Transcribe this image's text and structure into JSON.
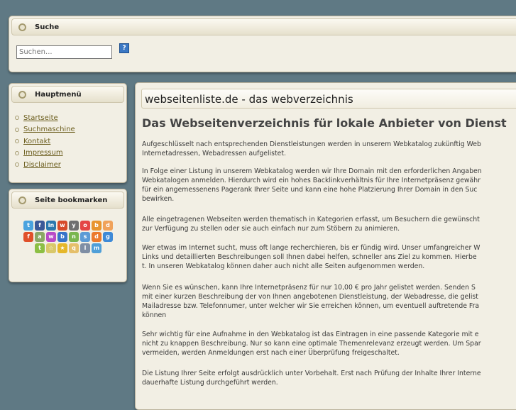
{
  "search": {
    "title": "Suche",
    "placeholder": "Suchen...",
    "help_label": "?"
  },
  "menu": {
    "title": "Hauptmenü",
    "items": [
      {
        "label": "Startseite"
      },
      {
        "label": "Suchmaschine"
      },
      {
        "label": "Kontakt"
      },
      {
        "label": "Impressum"
      },
      {
        "label": "Disclaimer"
      }
    ]
  },
  "bookmarks": {
    "title": "Seite bookmarken",
    "icons": [
      {
        "name": "twitter-icon",
        "glyph": "t",
        "color": "#4aa3df"
      },
      {
        "name": "facebook-icon",
        "glyph": "f",
        "color": "#3b5998"
      },
      {
        "name": "linkedin-icon",
        "glyph": "in",
        "color": "#2b78ae"
      },
      {
        "name": "mister-wong-icon",
        "glyph": "w",
        "color": "#d64b2b"
      },
      {
        "name": "yigg-icon",
        "glyph": "y",
        "color": "#6f6f6f"
      },
      {
        "name": "oneview-icon",
        "glyph": "o",
        "color": "#e44646"
      },
      {
        "name": "bookmarks-icon",
        "glyph": "b",
        "color": "#e8952e"
      },
      {
        "name": "delicious-icon",
        "glyph": "d",
        "color": "#f0a25a"
      },
      {
        "name": "folkd-icon",
        "glyph": "f",
        "color": "#e0502a"
      },
      {
        "name": "linkarena-icon",
        "glyph": "a",
        "color": "#8aa865"
      },
      {
        "name": "webnews-icon",
        "glyph": "w",
        "color": "#b84cc7"
      },
      {
        "name": "blinklist-icon",
        "glyph": "b",
        "color": "#3673c9"
      },
      {
        "name": "newsvine-icon",
        "glyph": "n",
        "color": "#7ab64e"
      },
      {
        "name": "stumbleupon-icon",
        "glyph": "s",
        "color": "#5c9bd6"
      },
      {
        "name": "digg-icon",
        "glyph": "d",
        "color": "#ec7a2c"
      },
      {
        "name": "google-icon",
        "glyph": "g",
        "color": "#3e8ad7"
      },
      {
        "name": "technorati-icon",
        "glyph": "t",
        "color": "#8cbf44"
      },
      {
        "name": "favorite-star-icon",
        "glyph": "☆",
        "color": "#d9c86a"
      },
      {
        "name": "star-icon",
        "glyph": "★",
        "color": "#e5b72a"
      },
      {
        "name": "search-bubble-icon",
        "glyph": "q",
        "color": "#e5bf6a"
      },
      {
        "name": "live-icon",
        "glyph": "l",
        "color": "#7f8ea4"
      },
      {
        "name": "misc-icon",
        "glyph": "m",
        "color": "#4f9fd8"
      }
    ]
  },
  "content": {
    "site_title": "webseitenliste.de - das webverzeichnis",
    "article_title": "Das Webseitenverzeichnis für lokale Anbieter von Dienst",
    "paragraphs": [
      {
        "lines": [
          "Aufgeschlüsselt nach entsprechenden Dienstleistungen werden in unserem Webkatalog zukünftig Web",
          "Internetadressen, Webadressen aufgelistet."
        ]
      },
      {
        "lines": [
          "In Folge einer Listung in unserem Webkatalog werden wir Ihre Domain mit den erforderlichen Angaben",
          "Webkatalogen anmelden. Hierdurch wird ein hohes Backlinkverhältnis für Ihre Internetpräsenz gewähr",
          "für ein angemessenens Pagerank Ihrer Seite und kann eine hohe Platzierung Ihrer Domain in den Suc",
          "bewirken."
        ]
      },
      {
        "lines": [
          "Alle eingetragenen Webseiten werden thematisch in Kategorien erfasst, um Besuchern die gewünscht",
          "zur Verfügung zu stellen oder sie auch einfach nur zum Stöbern zu animieren."
        ]
      },
      {
        "lines": [
          "Wer etwas im Internet sucht, muss oft lange recherchieren, bis er fündig wird. Unser umfangreicher W",
          "Links und detaillierten Beschreibungen soll Ihnen dabei helfen, schneller ans Ziel zu kommen. Hierbe",
          "t. In unseren Webkatalog können daher auch nicht alle Seiten aufgenommen werden."
        ]
      },
      {
        "lines": [
          "Wenn Sie es wünschen, kann Ihre Internetpräsenz für nur 10,00 € pro Jahr gelistet werden. Senden S",
          "mit einer kurzen Beschreibung der von Ihnen angebotenen Dienstleistung, der Webadresse, die gelist",
          "Mailadresse bzw. Telefonnumer, unter welcher wir Sie erreichen können, um eventuell auftretende Fra",
          "können"
        ]
      },
      {
        "lines": [
          "Sehr wichtig für eine Aufnahme in den Webkatalog ist das Eintragen in eine passende Kategorie mit e",
          "nicht zu knappen Beschreibung. Nur so kann eine optimale Themenrelevanz erzeugt werden. Um Spar",
          "vermeiden, werden Anmeldungen erst nach einer Überprüfung freigeschaltet."
        ]
      },
      {
        "lines": [
          "Die Listung Ihrer Seite erfolgt ausdrücklich unter Vorbehalt. Erst nach Prüfung der Inhalte Ihrer Interne",
          "dauerhafte Listung durchgeführt werden."
        ]
      }
    ]
  }
}
